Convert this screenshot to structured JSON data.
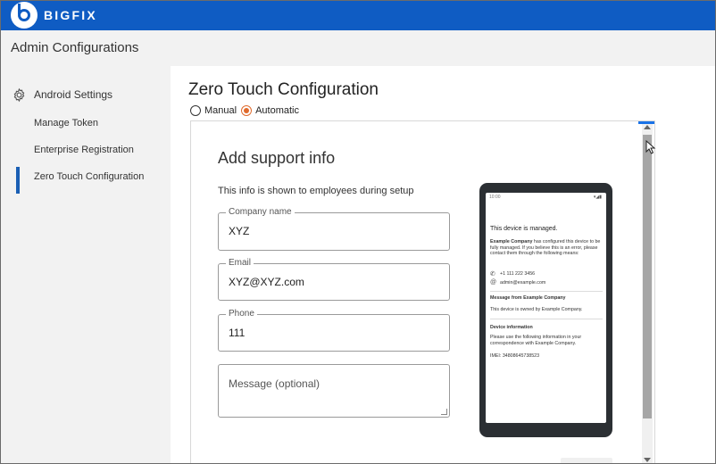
{
  "app": {
    "brand": "BIGFIX",
    "section_title": "Admin Configurations",
    "colors": {
      "brand_blue": "#0f5cc3",
      "accent_orange": "#e06a2c",
      "active_indicator": "#1a5fb4"
    }
  },
  "sidebar": {
    "heading": {
      "label": "Android Settings",
      "icon": "gear-icon"
    },
    "items": [
      {
        "label": "Manage Token",
        "active": false
      },
      {
        "label": "Enterprise Registration",
        "active": false
      },
      {
        "label": "Zero Touch Configuration",
        "active": true
      }
    ]
  },
  "main": {
    "title": "Zero Touch Configuration",
    "mode_options": [
      {
        "label": "Manual",
        "selected": false
      },
      {
        "label": "Automatic",
        "selected": true
      }
    ]
  },
  "support_form": {
    "heading": "Add support info",
    "description": "This info is shown to employees during setup",
    "company": {
      "label": "Company name",
      "value": "XYZ"
    },
    "email": {
      "label": "Email",
      "value": "XYZ@XYZ.com"
    },
    "phone": {
      "label": "Phone",
      "value": "111"
    },
    "message": {
      "placeholder": "Message (optional)"
    }
  },
  "phone_preview": {
    "status_time": "10:00",
    "title": "This device is managed.",
    "intro_bold": "Example Company",
    "intro_rest": " has configured this device to be fully managed. If you believe this is an error, please contact them through the following means:",
    "contact_phone": "+1 111 222 3456",
    "contact_email": "admin@example.com",
    "message_heading": "Message from Example Company",
    "message_body": "This device is owned by Example Company.",
    "device_heading": "Device information",
    "device_body": "Please use the following information in your correspondence with Example Company.",
    "imei": "IMEI: 34808645738523"
  }
}
